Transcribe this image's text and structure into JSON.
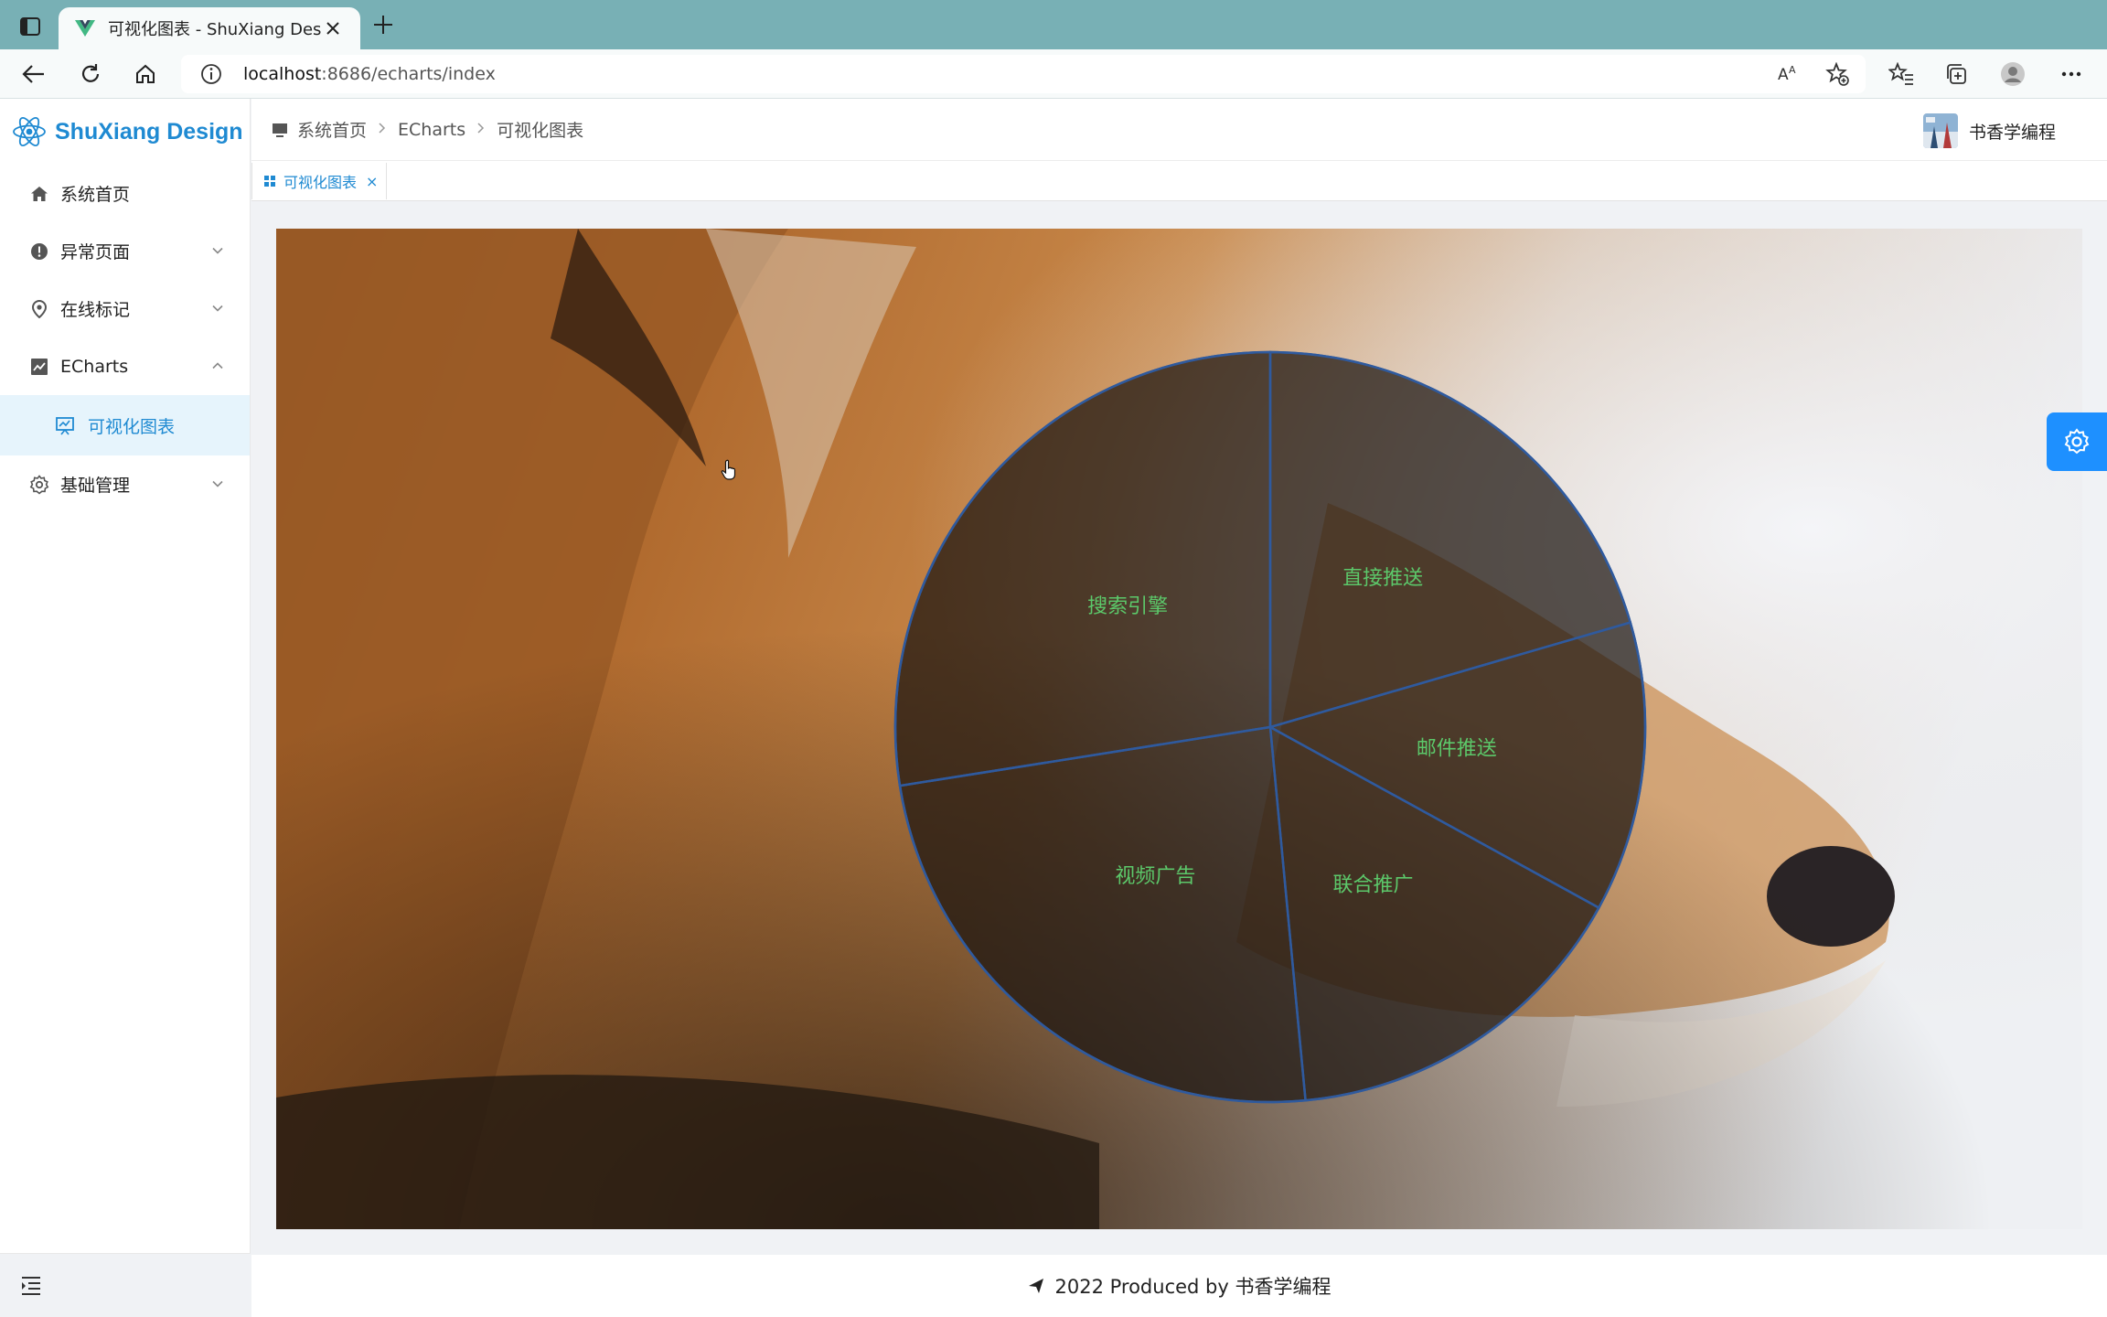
{
  "browser": {
    "tab_title": "可视化图表 - ShuXiang Design",
    "url_host": "localhost",
    "url_rest": ":8686/echarts/index"
  },
  "sidebar": {
    "brand": "ShuXiang Design",
    "items": [
      {
        "label": "系统首页"
      },
      {
        "label": "异常页面"
      },
      {
        "label": "在线标记"
      },
      {
        "label": "ECharts"
      },
      {
        "label": "基础管理"
      }
    ],
    "active_sub": "可视化图表"
  },
  "header": {
    "breadcrumb": [
      "系统首页",
      "ECharts",
      "可视化图表"
    ],
    "user": "书香学编程"
  },
  "tags": {
    "active": "可视化图表",
    "close": "×"
  },
  "footer": {
    "text": "2022 Produced by 书香学编程"
  },
  "colors": {
    "brand": "#1f8ad2",
    "active_bg": "#e6f4fc",
    "fab": "#1e90ff",
    "pie_label": "#5cc86a",
    "pie_stroke": "#2f5a9e"
  },
  "chart_data": {
    "type": "pie",
    "labels": [
      "直接推送",
      "邮件推送",
      "联合推广",
      "视频广告",
      "搜索引擎"
    ],
    "values": [
      20.5,
      12.5,
      15.5,
      24,
      27.5
    ]
  }
}
